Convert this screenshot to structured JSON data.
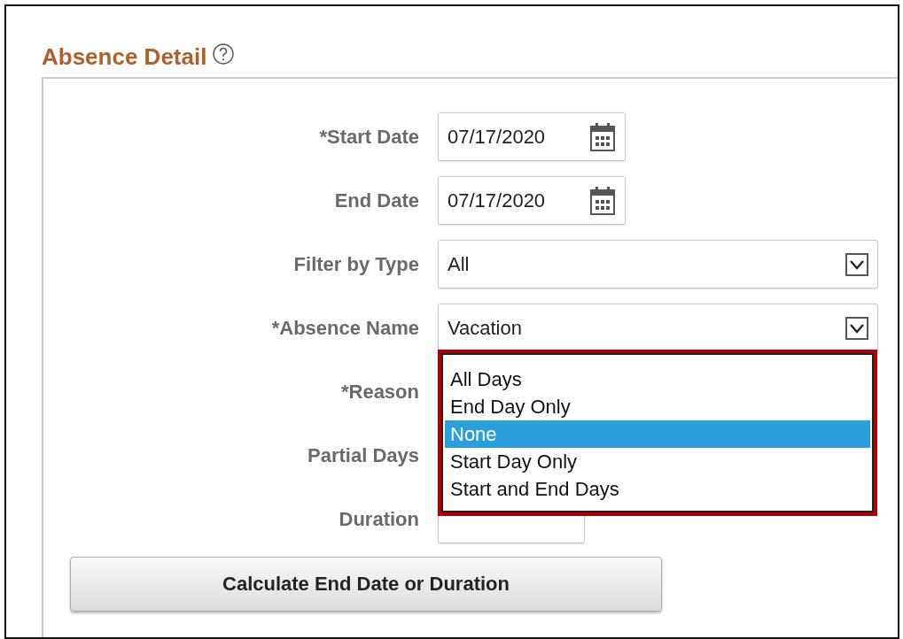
{
  "section": {
    "title": "Absence Detail"
  },
  "fields": [
    {
      "label": "*Start Date",
      "kind": "date",
      "value": "07/17/2020"
    },
    {
      "label": "End Date",
      "kind": "date",
      "value": "07/17/2020"
    },
    {
      "label": "Filter by Type",
      "kind": "select",
      "value": "All"
    },
    {
      "label": "*Absence Name",
      "kind": "select",
      "value": "Vacation"
    },
    {
      "label": "*Reason"
    },
    {
      "label": "Partial Days"
    },
    {
      "label": "Duration",
      "kind": "text"
    }
  ],
  "dropdown": {
    "options": [
      {
        "label": "All Days",
        "selected": false
      },
      {
        "label": "End Day Only",
        "selected": false
      },
      {
        "label": "None",
        "selected": true
      },
      {
        "label": "Start Day Only",
        "selected": false
      },
      {
        "label": "Start and End Days",
        "selected": false
      }
    ]
  },
  "buttons": [
    {
      "label": "Calculate End Date or Duration"
    }
  ]
}
